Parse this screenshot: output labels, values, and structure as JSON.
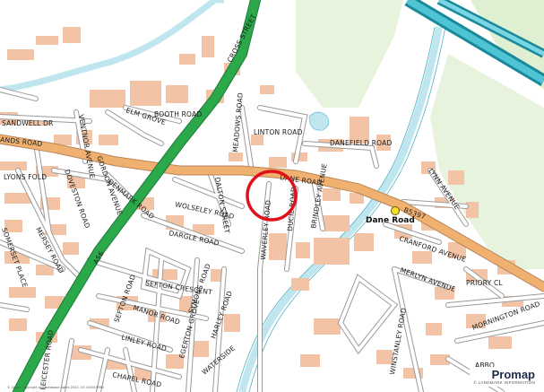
{
  "map": {
    "labels": {
      "cross_street": "CROSS STREET",
      "sandwell_dr": "SANDWELL DR",
      "ventnor_avenue": "VENTNOR AVENUE",
      "booth_road": "BOOTH ROAD",
      "elm_grove": "ELM GROVE",
      "lands_road": "ANDS ROAD",
      "meadows_road": "MEADOWS ROAD",
      "linton_road": "LINTON ROAD",
      "danefield_road": "DANEFIELD ROAD",
      "lyons_fold": "LYONS FOLD",
      "doveston_road": "DOVESTON ROAD",
      "gordon_avenue": "GORDON AVENUE",
      "denmark_road": "DENMARK ROAD",
      "dalton_street": "DALTON STREET",
      "dane_road": "DANE ROAD",
      "lynn_avenue": "LYNN AVENUE",
      "wolseley_road": "WOLSELEY ROAD",
      "waverley_road": "WAVERLEY ROAD",
      "ducie_road": "DUCIE ROAD",
      "brindley_avenue": "BRINDLEY AVENUE",
      "b5397": "B5397",
      "dane_road_station": "Dane Road",
      "merseyside": "MERSEY ROAD",
      "somerset_place": "SOMERSET PLACE",
      "dargle_road": "DARGLE ROAD",
      "cranford_avenue": "CRANFORD AVENUE",
      "a56": "A56",
      "sefton_crescent": "SEFTON CRESCENT",
      "merlyn_avenue": "MERLYN AVENUE",
      "priory_cl": "PRIORY CL",
      "sefton_road": "SEFTON ROAD",
      "symons_road": "SYMONS ROAD",
      "manor_road": "MANOR ROAD",
      "mornington_road": "MORNINGTON ROAD",
      "linley_road": "LINLEY ROAD",
      "harley_road": "HARLEY ROAD",
      "winstanley_road": "WINSTANLEY ROAD",
      "egerton_grove": "EGERTON GROVE",
      "waterside": "WATERSIDE",
      "leicester_road": "LEICESTER ROAD",
      "chapel_road": "CHAPEL ROAD",
      "abbey": "ABBO"
    },
    "brand": {
      "name": "Promap",
      "sub": "© LANDMARK INFORMATION"
    },
    "copyright": "© Crown copyright and database rights 2022. OS 100019980",
    "colors": {
      "building": "#f2c4a5",
      "main_road": "#2ba84a",
      "b_road": "#f0b070",
      "water": "#bfe6ef",
      "park": "#e6f2dc",
      "rail": "#1a8a9a",
      "marker": "#e0101a",
      "station": "#f3e02a"
    },
    "marker": "property-location-circle",
    "station_icon": "railway-station-dot"
  }
}
